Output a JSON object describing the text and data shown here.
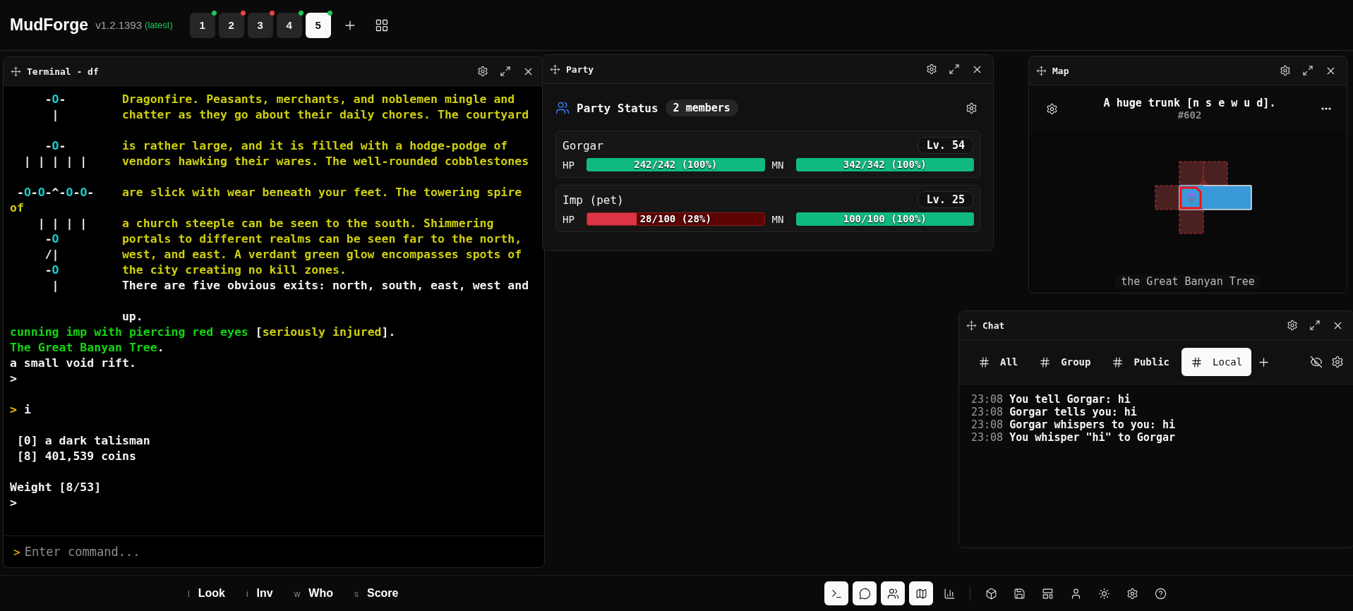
{
  "app": {
    "name": "MudForge",
    "version": "v1.2.1393",
    "channel": "(latest)"
  },
  "sessions": [
    {
      "label": "1",
      "color": "#22c55e",
      "selected": false
    },
    {
      "label": "2",
      "color": "#ef4444",
      "selected": false
    },
    {
      "label": "3",
      "color": "#ef4444",
      "selected": false
    },
    {
      "label": "4",
      "color": "#22c55e",
      "selected": false
    },
    {
      "label": "5",
      "color": "#22c55e",
      "selected": true
    }
  ],
  "terminal": {
    "title": "Terminal - df",
    "prompt": ">",
    "placeholder": "Enter command...",
    "lines": [
      {
        "kind": "art",
        "art": [
          {
            "t": "     -",
            "color": "#f2f2f2"
          },
          {
            "t": "O",
            "color": "#1ccfcf"
          },
          {
            "t": "-",
            "color": "#f2f2f2"
          }
        ],
        "text": [
          {
            "t": "Dragonfire. Peasants, merchants, and noblemen mingle and",
            "color": "#cfcf10"
          }
        ]
      },
      {
        "kind": "art",
        "art": [
          {
            "t": "      |",
            "color": "#f2f2f2"
          }
        ],
        "text": [
          {
            "t": "chatter as they go about their daily chores. The courtyard",
            "color": "#cfcf10"
          }
        ]
      },
      {
        "kind": "blank"
      },
      {
        "kind": "art",
        "art": [
          {
            "t": "     -",
            "color": "#f2f2f2"
          },
          {
            "t": "O",
            "color": "#1ccfcf"
          },
          {
            "t": "-",
            "color": "#f2f2f2"
          }
        ],
        "text": [
          {
            "t": "is rather large, and it is filled with a hodge-podge of",
            "color": "#cfcf10"
          }
        ]
      },
      {
        "kind": "art",
        "art": [
          {
            "t": "  | | | | |",
            "color": "#f2f2f2"
          }
        ],
        "text": [
          {
            "t": "vendors hawking their wares. The well-rounded cobblestones",
            "color": "#cfcf10"
          }
        ]
      },
      {
        "kind": "blank"
      },
      {
        "kind": "art",
        "art": [
          {
            "t": " -",
            "color": "#f2f2f2"
          },
          {
            "t": "O",
            "color": "#1ccfcf"
          },
          {
            "t": "-",
            "color": "#f2f2f2"
          },
          {
            "t": "O",
            "color": "#1ccfcf"
          },
          {
            "t": "-^-",
            "color": "#f2f2f2"
          },
          {
            "t": "O",
            "color": "#1ccfcf"
          },
          {
            "t": "-",
            "color": "#f2f2f2"
          },
          {
            "t": "O",
            "color": "#1ccfcf"
          },
          {
            "t": "-",
            "color": "#f2f2f2"
          }
        ],
        "text": [
          {
            "t": "are slick with wear beneath your feet. The towering spire",
            "color": "#cfcf10"
          }
        ]
      },
      {
        "kind": "plain",
        "text": [
          {
            "t": "of",
            "color": "#cfcf10"
          }
        ]
      },
      {
        "kind": "art",
        "art": [
          {
            "t": "    | | | |",
            "color": "#f2f2f2"
          }
        ],
        "text": [
          {
            "t": "a church steeple can be seen to the south. Shimmering",
            "color": "#cfcf10"
          }
        ]
      },
      {
        "kind": "art",
        "art": [
          {
            "t": "     -",
            "color": "#f2f2f2"
          },
          {
            "t": "O",
            "color": "#1ccfcf"
          }
        ],
        "text": [
          {
            "t": "portals to different realms can be seen far to the north,",
            "color": "#cfcf10"
          }
        ]
      },
      {
        "kind": "art",
        "art": [
          {
            "t": "     /|",
            "color": "#f2f2f2"
          }
        ],
        "text": [
          {
            "t": "west, and east. A verdant green glow encompasses spots of",
            "color": "#cfcf10"
          }
        ]
      },
      {
        "kind": "art",
        "art": [
          {
            "t": "     -",
            "color": "#f2f2f2"
          },
          {
            "t": "O",
            "color": "#1ccfcf"
          }
        ],
        "text": [
          {
            "t": "the city creating no kill zones.",
            "color": "#cfcf10"
          }
        ]
      },
      {
        "kind": "art",
        "art": [
          {
            "t": "      |",
            "color": "#f2f2f2"
          }
        ],
        "text": [
          {
            "t": "There are five obvious exits: north, south, east, west and",
            "color": "#f2f2f2"
          }
        ]
      },
      {
        "kind": "blank"
      },
      {
        "kind": "art",
        "text": [
          {
            "t": "up.",
            "color": "#f2f2f2"
          }
        ]
      },
      {
        "kind": "plain",
        "text": [
          {
            "t": "cunning imp with piercing red eyes ",
            "color": "#12d612"
          },
          {
            "t": "[",
            "color": "#f2f2f2"
          },
          {
            "t": "seriously injured",
            "color": "#cfcf10"
          },
          {
            "t": "].",
            "color": "#f2f2f2"
          }
        ]
      },
      {
        "kind": "plain",
        "text": [
          {
            "t": "The Great Banyan Tree",
            "color": "#12d612"
          },
          {
            "t": ".",
            "color": "#f2f2f2"
          }
        ]
      },
      {
        "kind": "plain",
        "text": [
          {
            "t": "a small void rift.",
            "color": "#f2f2f2"
          }
        ]
      },
      {
        "kind": "plain",
        "text": [
          {
            "t": ">",
            "color": "#f2f2f2"
          }
        ]
      },
      {
        "kind": "blank"
      },
      {
        "kind": "plain",
        "text": [
          {
            "t": "> ",
            "color": "#f5b800"
          },
          {
            "t": "i",
            "color": "#f2f2f2"
          }
        ]
      },
      {
        "kind": "blank"
      },
      {
        "kind": "plain",
        "text": [
          {
            "t": " [0] a dark talisman",
            "color": "#f2f2f2"
          }
        ]
      },
      {
        "kind": "plain",
        "text": [
          {
            "t": " [8] 401,539 coins",
            "color": "#f2f2f2"
          }
        ]
      },
      {
        "kind": "blank"
      },
      {
        "kind": "plain",
        "text": [
          {
            "t": "Weight [8/53]",
            "color": "#f2f2f2"
          }
        ]
      },
      {
        "kind": "plain",
        "text": [
          {
            "t": ">",
            "color": "#f2f2f2"
          }
        ]
      }
    ]
  },
  "party": {
    "title": "Party",
    "heading": "Party Status",
    "count": "2 members",
    "members": [
      {
        "name": "Gorgar",
        "level_label": "Lv. 54",
        "bars": [
          {
            "label": "HP",
            "reading": "242/242 (100%)",
            "level": 1
          },
          {
            "label": "MN",
            "reading": "342/342 (100%)",
            "level": 1
          }
        ]
      },
      {
        "name": "Imp (pet)",
        "level_label": "Lv. 25",
        "bars": [
          {
            "label": "HP",
            "reading": "28/100 (28%)",
            "level": 0.28
          },
          {
            "label": "MN",
            "reading": "100/100 (100%)",
            "level": 1
          }
        ]
      }
    ]
  },
  "map": {
    "title": "Map",
    "room": "A huge trunk [n s e w u d].",
    "room_id": "#602",
    "area": "the Great Banyan Tree"
  },
  "chat": {
    "title": "Chat",
    "tabs": [
      {
        "label": "All",
        "selected": false
      },
      {
        "label": "Group",
        "selected": false
      },
      {
        "label": "Public",
        "selected": false
      },
      {
        "label": "Local",
        "selected": true
      }
    ],
    "messages": [
      {
        "time": "23:08",
        "text": "You tell Gorgar: hi"
      },
      {
        "time": "23:08",
        "text": "Gorgar tells you: hi"
      },
      {
        "time": "23:08",
        "text": "Gorgar whispers to you: hi"
      },
      {
        "time": "23:08",
        "text": "You whisper \"hi\" to Gorgar"
      }
    ]
  },
  "hotkeys": [
    {
      "key": "l",
      "label": "Look"
    },
    {
      "key": "i",
      "label": "Inv"
    },
    {
      "key": "w",
      "label": "Who"
    },
    {
      "key": "s",
      "label": "Score"
    }
  ],
  "panel_toggles": [
    {
      "on": true
    },
    {
      "on": true
    },
    {
      "on": true
    },
    {
      "on": true
    },
    {
      "on": false
    }
  ]
}
